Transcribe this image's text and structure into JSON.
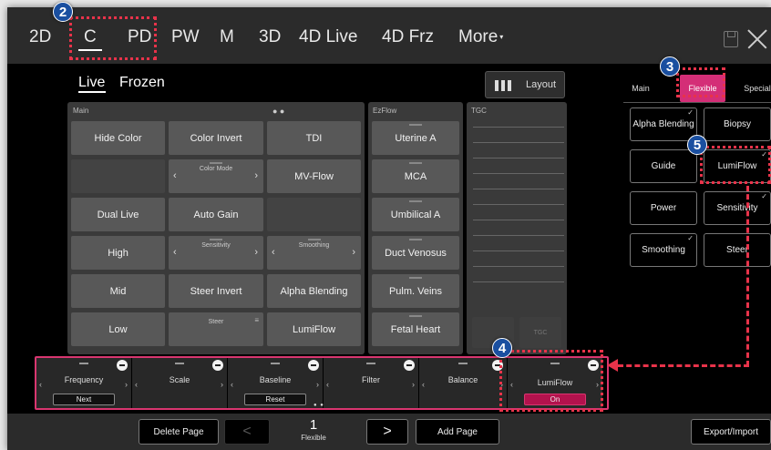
{
  "top_modes": [
    "2D",
    "C",
    "PD",
    "PW",
    "M",
    "3D",
    "4D Live",
    "4D Frz",
    "More"
  ],
  "live_label": "Live",
  "frozen_label": "Frozen",
  "layout_label": "Layout",
  "main_panel": {
    "title": "Main",
    "dots": "● ●",
    "buttons": {
      "hide_color": "Hide Color",
      "color_invert": "Color Invert",
      "tdi": "TDI",
      "color_mode": "Color Mode",
      "mv_flow": "MV-Flow",
      "dual_live": "Dual Live",
      "auto_gain": "Auto Gain",
      "high": "High",
      "sensitivity": "Sensitivity",
      "smoothing": "Smoothing",
      "mid": "Mid",
      "steer_invert": "Steer Invert",
      "alpha_blending": "Alpha Blending",
      "low": "Low",
      "steer": "Steer",
      "lumiflow": "LumiFlow"
    }
  },
  "ezflow_panel": {
    "title": "EzFlow",
    "buttons": [
      "Uterine A",
      "MCA",
      "Umbilical A",
      "Duct Venosus",
      "Pulm. Veins",
      "Fetal Heart"
    ]
  },
  "tgc_panel": {
    "title": "TGC",
    "button": "TGC"
  },
  "right_tabs": {
    "main": "Main",
    "flexible": "Flexible",
    "special": "Special"
  },
  "flex_buttons": [
    "Alpha Blending",
    "Biopsy",
    "Guide",
    "LumiFlow",
    "Power",
    "Sensitivity",
    "Smoothing",
    "Steer"
  ],
  "knobs": [
    {
      "label": "Frequency",
      "sub": "Next"
    },
    {
      "label": "Scale",
      "sub": ""
    },
    {
      "label": "Baseline",
      "sub": "Reset"
    },
    {
      "label": "Filter",
      "sub": ""
    },
    {
      "label": "Balance",
      "sub": ""
    },
    {
      "label": "LumiFlow",
      "sub": "On"
    }
  ],
  "bottom": {
    "delete_page": "Delete Page",
    "prev": "<",
    "page_number": "1",
    "page_name": "Flexible",
    "next": ">",
    "add_page": "Add Page",
    "export_import": "Export/Import"
  },
  "badges": [
    "2",
    "3",
    "4",
    "5"
  ],
  "colors": {
    "accent": "#d93670",
    "annotation": "#e8334a",
    "badge": "#1a4fa0"
  }
}
